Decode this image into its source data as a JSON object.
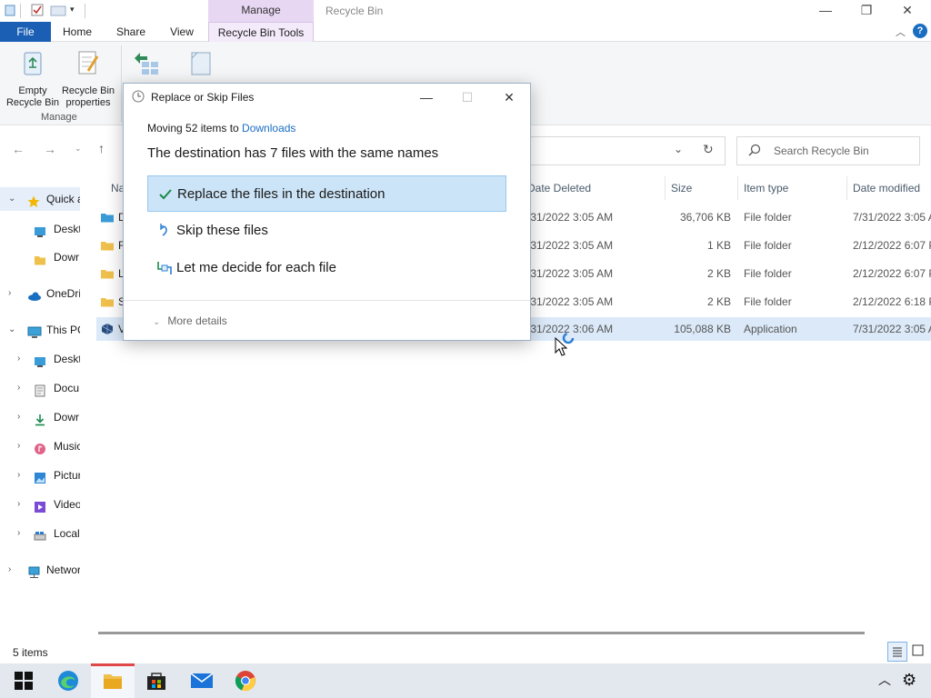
{
  "window": {
    "title": "Recycle Bin",
    "context_tab_group": "Manage",
    "controls": {
      "minimize": "—",
      "maximize": "❐",
      "close": "✕"
    }
  },
  "ribbon_tabs": {
    "file": "File",
    "home": "Home",
    "share": "Share",
    "view": "View",
    "recycle_bin_tools": "Recycle Bin Tools"
  },
  "ribbon": {
    "empty_recycle_bin": "Empty\nRecycle Bin",
    "empty_line1": "Empty",
    "empty_line2": "Recycle Bin",
    "properties_line1": "Recycle Bin",
    "properties_line2": "properties",
    "group_label": "Manage"
  },
  "search": {
    "placeholder": "Search Recycle Bin"
  },
  "nav": {
    "items": [
      {
        "label": "Quick a",
        "icon": "star-icon"
      },
      {
        "label": "Deskt",
        "icon": "desktop-icon"
      },
      {
        "label": "Dowr",
        "icon": "folder-icon"
      },
      {
        "label": "OneDri",
        "icon": "cloud-icon"
      },
      {
        "label": "This PC",
        "icon": "computer-icon"
      },
      {
        "label": "Deskt",
        "icon": "desktop-icon"
      },
      {
        "label": "Docu",
        "icon": "documents-icon"
      },
      {
        "label": "Dowr",
        "icon": "download-icon"
      },
      {
        "label": "Music",
        "icon": "music-icon"
      },
      {
        "label": "Pictur",
        "icon": "pictures-icon"
      },
      {
        "label": "Video",
        "icon": "video-icon"
      },
      {
        "label": "Local",
        "icon": "drive-icon"
      },
      {
        "label": "Networ",
        "icon": "network-icon"
      }
    ]
  },
  "columns": {
    "name": "Na",
    "date_deleted": "Date Deleted",
    "size": "Size",
    "item_type": "Item type",
    "date_modified": "Date modified"
  },
  "rows": [
    {
      "name": "D",
      "date_deleted": "/31/2022 3:05 AM",
      "size": "36,706 KB",
      "type": "File folder",
      "modified": "7/31/2022 3:05 A"
    },
    {
      "name": "F",
      "date_deleted": "/31/2022 3:05 AM",
      "size": "1 KB",
      "type": "File folder",
      "modified": "2/12/2022 6:07 P"
    },
    {
      "name": "L",
      "date_deleted": "/31/2022 3:05 AM",
      "size": "2 KB",
      "type": "File folder",
      "modified": "2/12/2022 6:07 P"
    },
    {
      "name": "S",
      "date_deleted": "/31/2022 3:05 AM",
      "size": "2 KB",
      "type": "File folder",
      "modified": "2/12/2022 6:18 P"
    },
    {
      "name": "V",
      "date_deleted": "/31/2022 3:06 AM",
      "size": "105,088 KB",
      "type": "Application",
      "modified": "7/31/2022 3:05 A"
    }
  ],
  "dialog": {
    "title": "Replace or Skip Files",
    "moving_prefix": "Moving 52 items to ",
    "destination": "Downloads",
    "heading": "The destination has 7 files with the same names",
    "option_replace": "Replace the files in the destination",
    "option_skip": "Skip these files",
    "option_decide": "Let me decide for each file",
    "more_details": "More details"
  },
  "status": {
    "item_count": "5 items"
  },
  "colors": {
    "accent": "#1a5fb4",
    "manage_tab": "#e8d7f3",
    "selection": "#cce4f7",
    "link": "#1a6ec2"
  }
}
